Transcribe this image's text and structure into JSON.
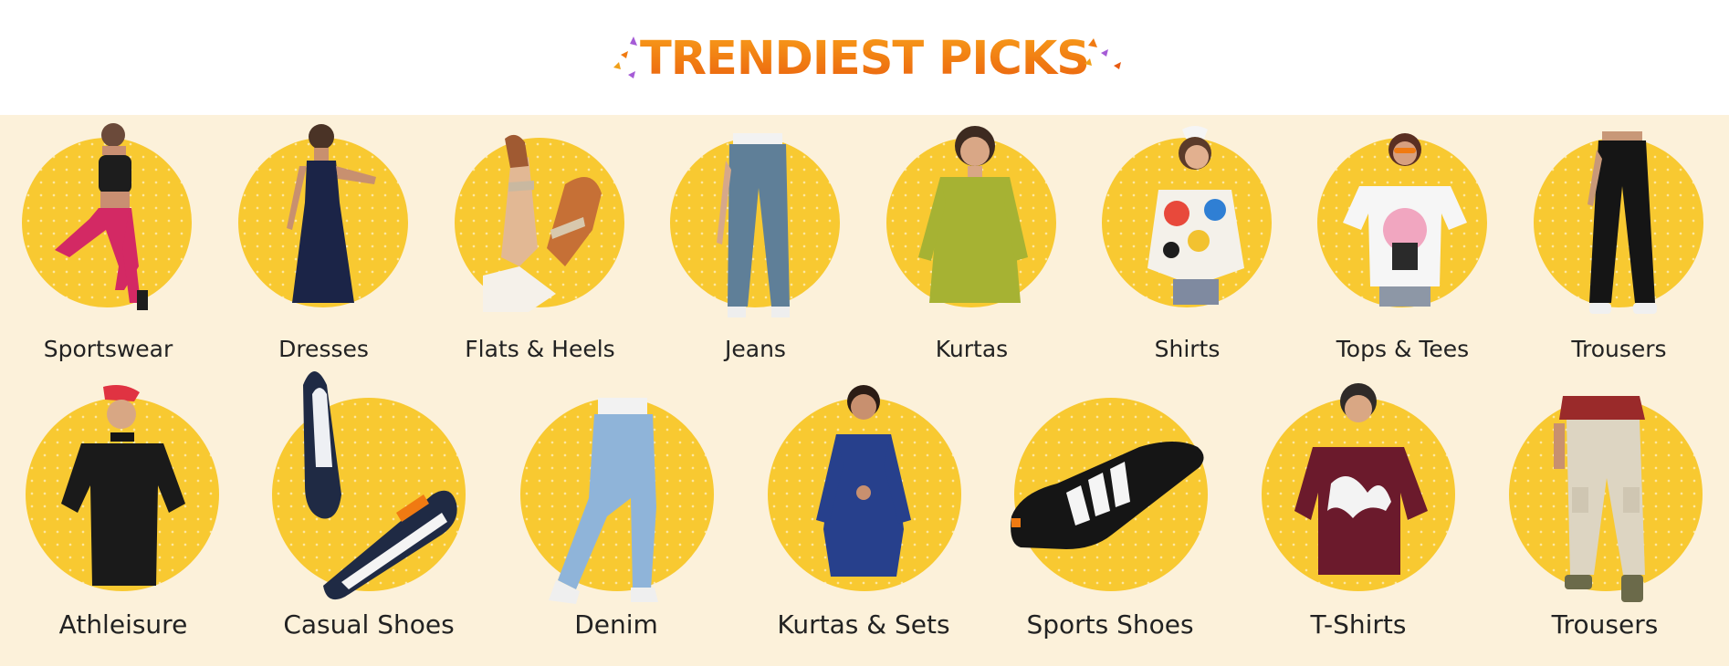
{
  "section": {
    "title": "TRENDIEST PICKS"
  },
  "categories_row1": [
    {
      "label": "Sportswear",
      "icon": "sportswear-model-image"
    },
    {
      "label": "Dresses",
      "icon": "dress-model-image"
    },
    {
      "label": "Flats & Heels",
      "icon": "sandals-image"
    },
    {
      "label": "Jeans",
      "icon": "jeans-model-image"
    },
    {
      "label": "Kurtas",
      "icon": "kurta-model-image"
    },
    {
      "label": "Shirts",
      "icon": "shirt-model-image"
    },
    {
      "label": "Tops & Tees",
      "icon": "top-model-image"
    },
    {
      "label": "Trousers",
      "icon": "trousers-model-image"
    }
  ],
  "categories_row2": [
    {
      "label": "Athleisure",
      "icon": "athleisure-model-image"
    },
    {
      "label": "Casual Shoes",
      "icon": "casual-shoes-image"
    },
    {
      "label": "Denim",
      "icon": "denim-model-image"
    },
    {
      "label": "Kurtas & Sets",
      "icon": "kurta-set-model-image"
    },
    {
      "label": "Sports Shoes",
      "icon": "sports-shoe-image"
    },
    {
      "label": "T-Shirts",
      "icon": "tshirt-model-image"
    },
    {
      "label": "Trousers",
      "icon": "cargo-trousers-model-image"
    }
  ],
  "colors": {
    "circle": "#f8c931",
    "panel_background": "#fcf1da",
    "title_orange": "#f07a12"
  }
}
